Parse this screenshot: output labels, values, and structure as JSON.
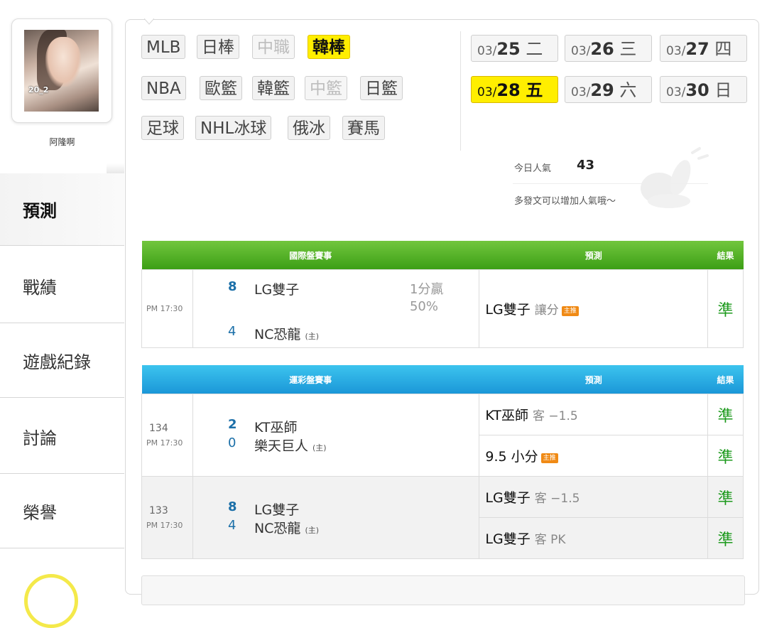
{
  "sidebar": {
    "avatar_year": "20_2",
    "username": "阿隆啊",
    "nav": [
      "預測",
      "戰績",
      "遊戲紀錄",
      "討論",
      "榮譽"
    ]
  },
  "sports": {
    "row1": [
      {
        "label": "MLB",
        "state": "normal"
      },
      {
        "label": "日棒",
        "state": "normal"
      },
      {
        "label": "中職",
        "state": "disabled"
      },
      {
        "label": "韓棒",
        "state": "active"
      }
    ],
    "row2": [
      {
        "label": "NBA",
        "state": "normal"
      },
      {
        "label": "歐籃",
        "state": "normal"
      },
      {
        "label": "韓籃",
        "state": "normal"
      },
      {
        "label": "中籃",
        "state": "disabled"
      },
      {
        "label": "日籃",
        "state": "normal"
      }
    ],
    "row3": [
      {
        "label": "足球",
        "state": "normal"
      },
      {
        "label": "NHL冰球",
        "state": "normal"
      },
      {
        "label": "俄冰",
        "state": "normal"
      },
      {
        "label": "賽馬",
        "state": "normal"
      }
    ]
  },
  "dates": [
    {
      "md": "03/",
      "day": "25",
      "wk": "二",
      "active": false
    },
    {
      "md": "03/",
      "day": "26",
      "wk": "三",
      "active": false
    },
    {
      "md": "03/",
      "day": "27",
      "wk": "四",
      "active": false
    },
    {
      "md": "03/",
      "day": "28",
      "wk": "五",
      "active": true
    },
    {
      "md": "03/",
      "day": "29",
      "wk": "六",
      "active": false
    },
    {
      "md": "03/",
      "day": "30",
      "wk": "日",
      "active": false
    }
  ],
  "popularity": {
    "label": "今日人氣",
    "value": "43",
    "note": "多發文可以增加人氣哦～"
  },
  "intl_table": {
    "headers": [
      "國際盤賽事",
      "預測",
      "結果"
    ],
    "rows": [
      {
        "time": "PM 17:30",
        "away_score": "8",
        "away_team": "LG雙子",
        "home_score": "4",
        "home_team": "NC恐龍",
        "home_tag": "(主)",
        "handicap_line1": "1分贏",
        "handicap_line2": "50%",
        "pred_team": "LG雙子",
        "pred_type": "讓分",
        "pred_badge": "主推",
        "result": "準"
      }
    ]
  },
  "lottery_table": {
    "headers": [
      "運彩盤賽事",
      "預測",
      "結果"
    ],
    "games": [
      {
        "no": "134",
        "time": "PM 17:30",
        "away_score": "2",
        "away_team": "KT巫師",
        "home_score": "0",
        "home_team": "樂天巨人",
        "home_tag": "(主)",
        "picks": [
          {
            "main": "KT巫師",
            "sub": "客 −1.5",
            "badge": "",
            "result": "準"
          },
          {
            "main": "9.5 小分",
            "sub": "",
            "badge": "主推",
            "result": "準"
          }
        ]
      },
      {
        "no": "133",
        "time": "PM 17:30",
        "away_score": "8",
        "away_team": "LG雙子",
        "home_score": "4",
        "home_team": "NC恐龍",
        "home_tag": "(主)",
        "picks": [
          {
            "main": "LG雙子",
            "sub": "客 −1.5",
            "badge": "",
            "result": "準"
          },
          {
            "main": "LG雙子",
            "sub": "客 PK",
            "badge": "",
            "result": "準"
          }
        ]
      }
    ]
  },
  "colors": {
    "active_yellow": "#ffee00",
    "intl_header_green": "#3c9f16",
    "lottery_header_blue": "#1b97d8",
    "result_green": "#1d9a1d",
    "score_blue": "#1b6fa8",
    "badge_orange": "#f08a15"
  }
}
